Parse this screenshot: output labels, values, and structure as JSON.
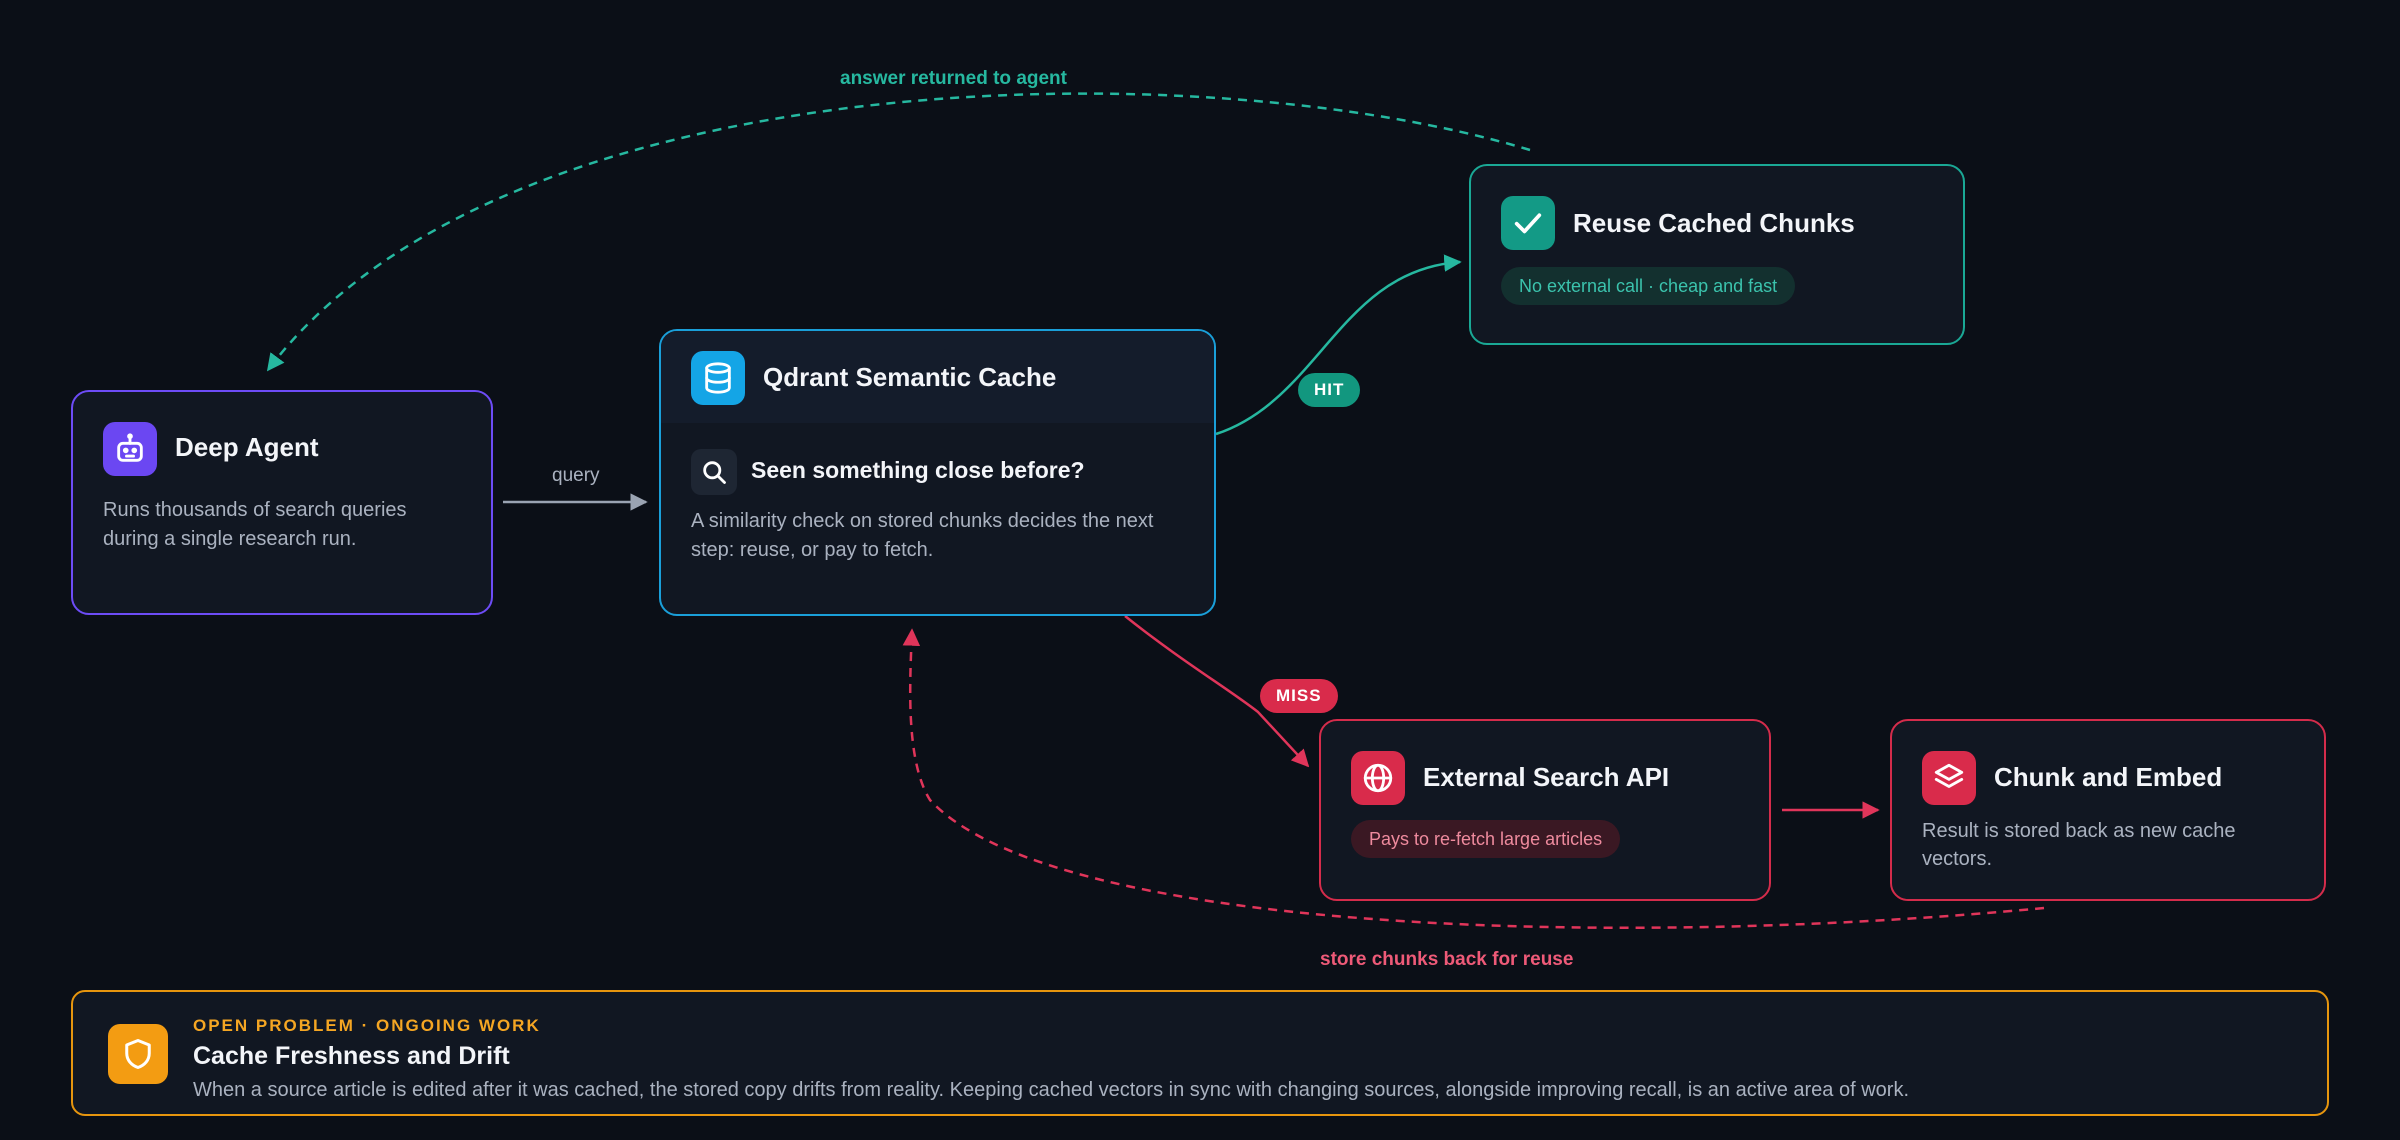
{
  "colors": {
    "background": "#0b0f17",
    "agent_accent": "#6d4cf6",
    "cache_accent": "#1a9fd9",
    "hit_accent": "#1aa895",
    "miss_accent": "#d42c4b",
    "problem_accent": "#f39c12"
  },
  "nodes": {
    "agent": {
      "icon": "robot-icon",
      "title": "Deep Agent",
      "description": "Runs thousands of search queries during a single research run."
    },
    "cache": {
      "icon": "database-icon",
      "title": "Qdrant Semantic Cache",
      "sub_icon": "search-icon",
      "subtitle": "Seen something close before?",
      "description": "A similarity check on stored chunks decides the next step: reuse, or pay to fetch."
    },
    "reuse": {
      "icon": "check-icon",
      "title": "Reuse Cached Chunks",
      "pill": "No external call · cheap and fast"
    },
    "search_api": {
      "icon": "globe-icon",
      "title": "External Search API",
      "pill": "Pays to re-fetch large articles"
    },
    "embed": {
      "icon": "layers-icon",
      "title": "Chunk and Embed",
      "description": "Result is stored back as new cache vectors."
    }
  },
  "edges": {
    "query_label": "query",
    "hit_label": "HIT",
    "miss_label": "MISS",
    "answer_label": "answer returned to agent",
    "store_label": "store chunks back for reuse"
  },
  "problem": {
    "icon": "shield-icon",
    "kicker": "OPEN PROBLEM · ONGOING WORK",
    "title": "Cache Freshness and Drift",
    "description": "When a source article is edited after it was cached, the stored copy drifts from reality. Keeping cached vectors in sync with changing sources, alongside improving recall, is an active area of work."
  }
}
